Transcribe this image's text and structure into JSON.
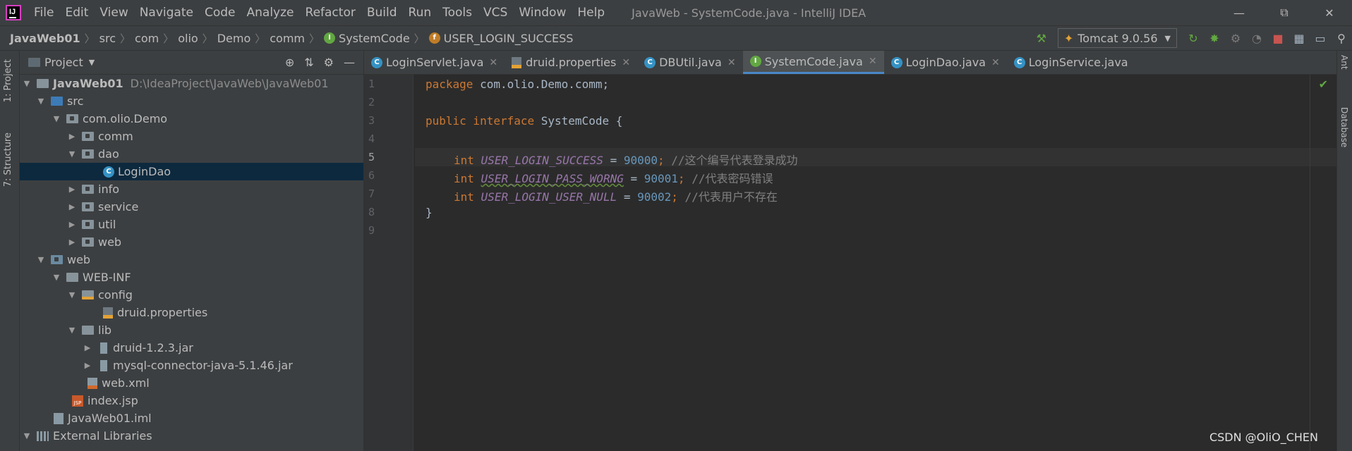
{
  "menubar": {
    "items": [
      "File",
      "Edit",
      "View",
      "Navigate",
      "Code",
      "Analyze",
      "Refactor",
      "Build",
      "Run",
      "Tools",
      "VCS",
      "Window",
      "Help"
    ],
    "window_title": "JavaWeb - SystemCode.java - IntelliJ IDEA"
  },
  "breadcrumb": {
    "items": [
      "JavaWeb01",
      "src",
      "com",
      "olio",
      "Demo",
      "comm",
      "SystemCode",
      "USER_LOGIN_SUCCESS"
    ]
  },
  "run_config": {
    "label": "Tomcat 9.0.56"
  },
  "left_strip": {
    "project_tab": "1: Project",
    "structure_tab": "7: Structure"
  },
  "right_strip": {
    "ant_tab": "Ant",
    "database_tab": "Database"
  },
  "project_panel": {
    "title": "Project",
    "tree": [
      {
        "label": "JavaWeb01",
        "path": "D:\\IdeaProject\\JavaWeb\\JavaWeb01"
      },
      {
        "label": "src"
      },
      {
        "label": "com.olio.Demo"
      },
      {
        "label": "comm"
      },
      {
        "label": "dao"
      },
      {
        "label": "LoginDao"
      },
      {
        "label": "info"
      },
      {
        "label": "service"
      },
      {
        "label": "util"
      },
      {
        "label": "web"
      },
      {
        "label": "web"
      },
      {
        "label": "WEB-INF"
      },
      {
        "label": "config"
      },
      {
        "label": "druid.properties"
      },
      {
        "label": "lib"
      },
      {
        "label": "druid-1.2.3.jar"
      },
      {
        "label": "mysql-connector-java-5.1.46.jar"
      },
      {
        "label": "web.xml"
      },
      {
        "label": "index.jsp"
      },
      {
        "label": "JavaWeb01.iml"
      },
      {
        "label": "External Libraries"
      }
    ]
  },
  "tabs": [
    "LoginServlet.java",
    "druid.properties",
    "DBUtil.java",
    "SystemCode.java",
    "LoginDao.java",
    "LoginService.java"
  ],
  "editor": {
    "line_numbers": [
      "1",
      "2",
      "3",
      "4",
      "5",
      "6",
      "7",
      "8",
      "9"
    ],
    "current_line": "5",
    "lines": {
      "l1_kw": "package",
      "l1_rest": " com.olio.Demo.comm;",
      "l3_kw": "public interface",
      "l3_rest": " SystemCode {",
      "l5_kw": "int",
      "l5_const": "USER_LOGIN_SUCCESS",
      "l5_eq": " = ",
      "l5_num": "90000",
      "l5_semi": "; ",
      "l5_cmt": "//这个编号代表登录成功",
      "l6_kw": "int",
      "l6_const": "USER_LOGIN_PASS_WORNG",
      "l6_eq": " = ",
      "l6_num": "90001",
      "l6_semi": "; ",
      "l6_cmt": "//代表密码错误",
      "l7_kw": "int",
      "l7_const": "USER_LOGIN_USER_NULL",
      "l7_eq": " = ",
      "l7_num": "90002",
      "l7_semi": "; ",
      "l7_cmt": "//代表用户不存在",
      "l8": "}"
    }
  },
  "watermark": "CSDN @OliO_CHEN",
  "colors": {
    "keyword": "#cc7832",
    "constant": "#9876aa",
    "number": "#6897bb",
    "comment": "#808080",
    "selection": "#0d293e",
    "active_tab_accent": "#4a88c7"
  }
}
